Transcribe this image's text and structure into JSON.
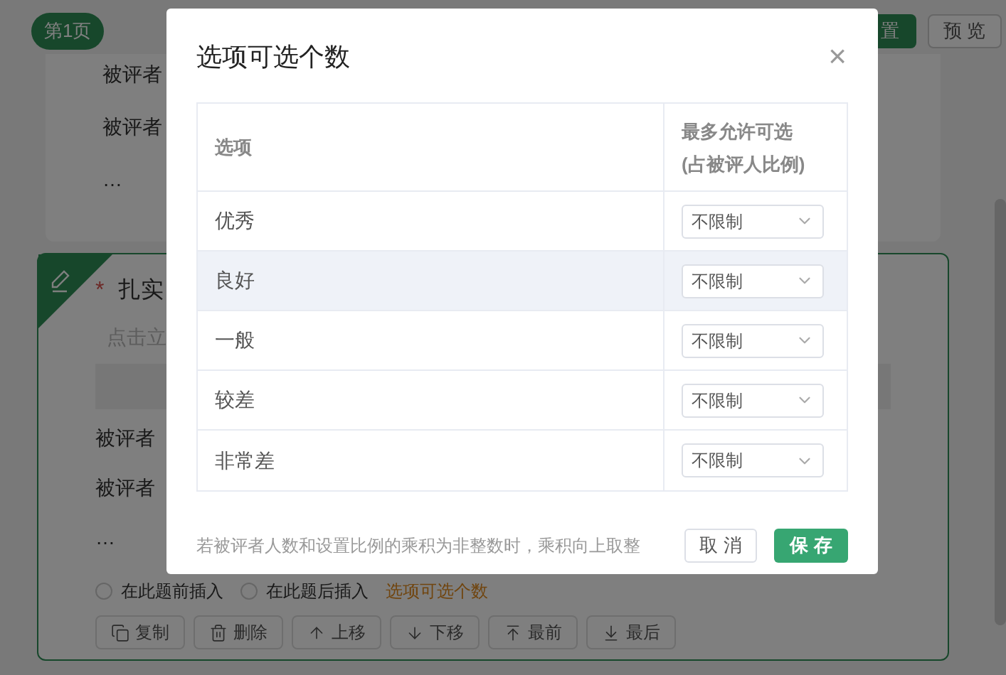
{
  "page": {
    "page_tab": "第1页",
    "toolbar_buttons": [
      {
        "label": "置",
        "kind": "primary"
      },
      {
        "label": "预 览",
        "kind": "secondary"
      }
    ]
  },
  "question_above": {
    "lines": [
      "被评者",
      "被评者",
      "…"
    ]
  },
  "question": {
    "required_mark": "*",
    "title": "扎实",
    "placeholder": "点击立",
    "lines": [
      "被评者",
      "被评者",
      "…"
    ],
    "insert_options": [
      {
        "label": "在此题前插入",
        "selected": false
      },
      {
        "label": "在此题后插入",
        "selected": false
      }
    ],
    "link": "选项可选个数",
    "actions": [
      {
        "label": "复制"
      },
      {
        "label": "删除"
      },
      {
        "label": "上移"
      },
      {
        "label": "下移"
      },
      {
        "label": "最前"
      },
      {
        "label": "最后"
      }
    ]
  },
  "dialog": {
    "title": "选项可选个数",
    "close": "×",
    "columns": [
      {
        "lines": [
          "选项"
        ]
      },
      {
        "lines": [
          "最多允许可选",
          "(占被评人比例)"
        ]
      }
    ],
    "rows": [
      {
        "option": "优秀",
        "limit": "不限制",
        "highlighted": false
      },
      {
        "option": "良好",
        "limit": "不限制",
        "highlighted": true
      },
      {
        "option": "一般",
        "limit": "不限制",
        "highlighted": false
      },
      {
        "option": "较差",
        "limit": "不限制",
        "highlighted": false
      },
      {
        "option": "非常差",
        "limit": "不限制",
        "highlighted": false
      }
    ],
    "note": "若被评者人数和设置比例的乘积为非整数时，乘积向上取整",
    "buttons": [
      {
        "label": "取 消",
        "kind": "secondary"
      },
      {
        "label": "保 存",
        "kind": "primary"
      }
    ]
  }
}
